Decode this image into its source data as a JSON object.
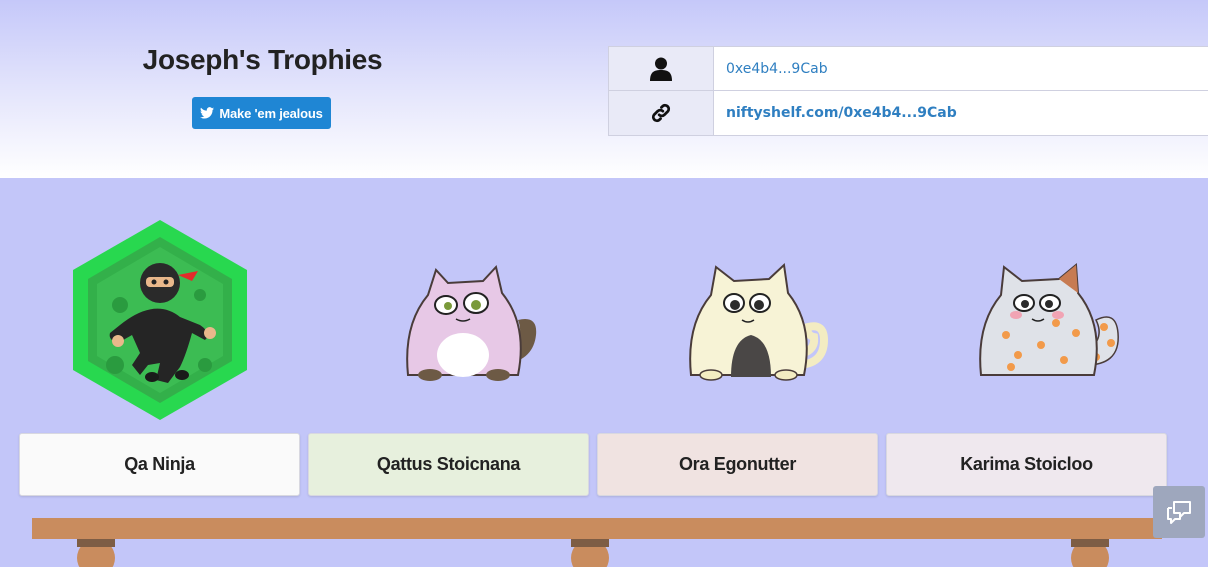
{
  "header": {
    "title": "Joseph's Trophies",
    "share_label": "Make 'em jealous"
  },
  "info": {
    "address": "0xe4b4...9Cab",
    "shelf_link": "niftyshelf.com/0xe4b4...9Cab"
  },
  "trophies": [
    {
      "name": "Qa Ninja",
      "card_color": "#fafafa",
      "icon": "ninja-hexagon-badge"
    },
    {
      "name": "Qattus Stoicnana",
      "card_color": "#e7f0dd",
      "icon": "pink-cat"
    },
    {
      "name": "Ora Egonutter",
      "card_color": "#f0e3e1",
      "icon": "cream-cat"
    },
    {
      "name": "Karima Stoicloo",
      "card_color": "#efe8ee",
      "icon": "spotted-cat"
    }
  ],
  "colors": {
    "background": "#c3c6f9",
    "accent": "#1f86d4",
    "link": "#2f7fc1",
    "shelf": "#c98c5e"
  }
}
